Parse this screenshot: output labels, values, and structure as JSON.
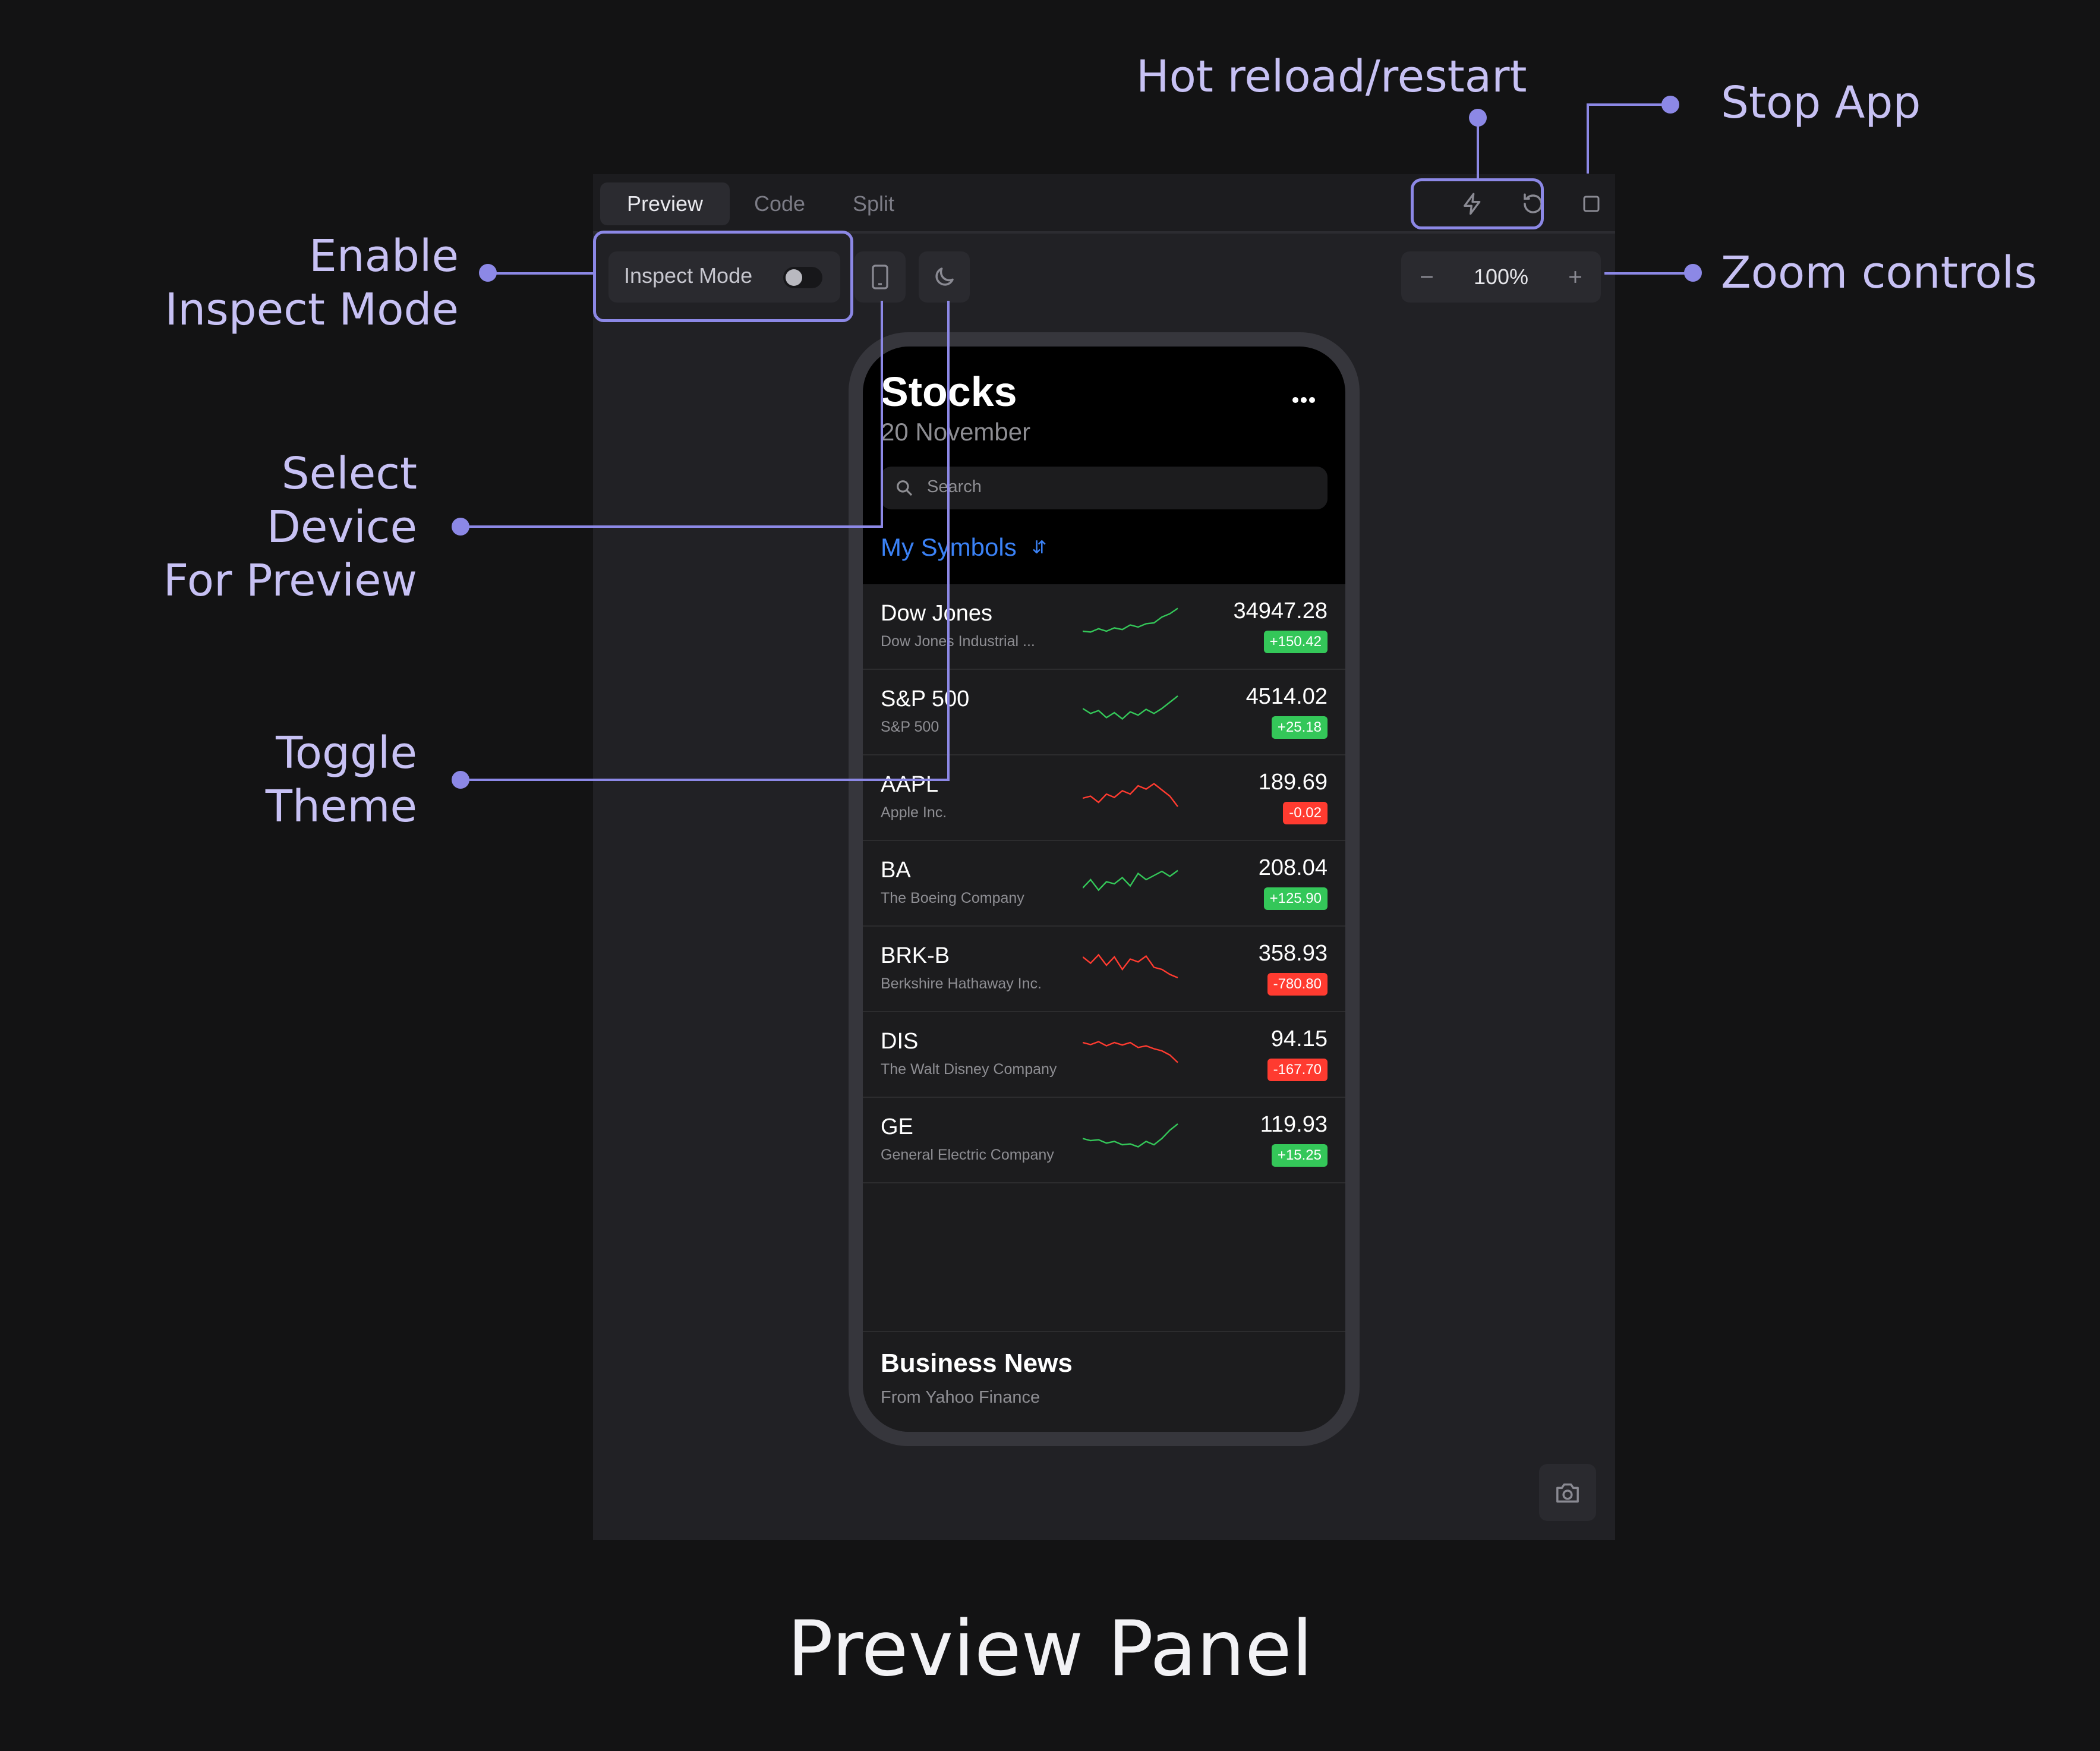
{
  "annotations": {
    "hot_reload": "Hot reload/restart",
    "stop_app": "Stop App",
    "inspect_line1": "Enable",
    "inspect_line2": "Inspect Mode",
    "zoom": "Zoom controls",
    "device_line1": "Select",
    "device_line2": "Device",
    "device_line3": "For Preview",
    "theme_line1": "Toggle",
    "theme_line2": "Theme"
  },
  "caption": "Preview Panel",
  "tabs": [
    "Preview",
    "Code",
    "Split"
  ],
  "active_tab": "Preview",
  "toolbar": {
    "inspect_label": "Inspect Mode",
    "inspect_enabled": false,
    "zoom_value": "100%"
  },
  "colors": {
    "accent": "#8c88e6",
    "annotation_text": "#c7c1f4",
    "positive": "#34c759",
    "negative": "#ff3b30",
    "link_blue": "#3b82f6"
  },
  "icons": {
    "hot_reload": "lightning-icon",
    "restart": "restart-icon",
    "stop": "stop-icon",
    "device": "phone-icon",
    "theme": "moon-icon",
    "zoom_out": "minus-icon",
    "zoom_in": "plus-icon",
    "screenshot": "camera-icon",
    "more": "ellipsis-icon",
    "search": "search-icon"
  },
  "app": {
    "title": "Stocks",
    "date": "20 November",
    "search_placeholder": "Search",
    "section": "My Symbols",
    "stocks": [
      {
        "symbol": "Dow Jones",
        "name": "Dow Jones Industrial ...",
        "price": "34947.28",
        "change": "+150.42",
        "positive": true
      },
      {
        "symbol": "S&P 500",
        "name": "S&P 500",
        "price": "4514.02",
        "change": "+25.18",
        "positive": true
      },
      {
        "symbol": "AAPL",
        "name": "Apple Inc.",
        "price": "189.69",
        "change": "-0.02",
        "positive": false
      },
      {
        "symbol": "BA",
        "name": "The Boeing Company",
        "price": "208.04",
        "change": "+125.90",
        "positive": true
      },
      {
        "symbol": "BRK-B",
        "name": "Berkshire Hathaway Inc.",
        "price": "358.93",
        "change": "-780.80",
        "positive": false
      },
      {
        "symbol": "DIS",
        "name": "The Walt Disney Company",
        "price": "94.15",
        "change": "-167.70",
        "positive": false
      },
      {
        "symbol": "GE",
        "name": "General Electric Company",
        "price": "119.93",
        "change": "+15.25",
        "positive": true
      }
    ],
    "news_title": "Business News",
    "news_subtitle": "From Yahoo Finance"
  }
}
